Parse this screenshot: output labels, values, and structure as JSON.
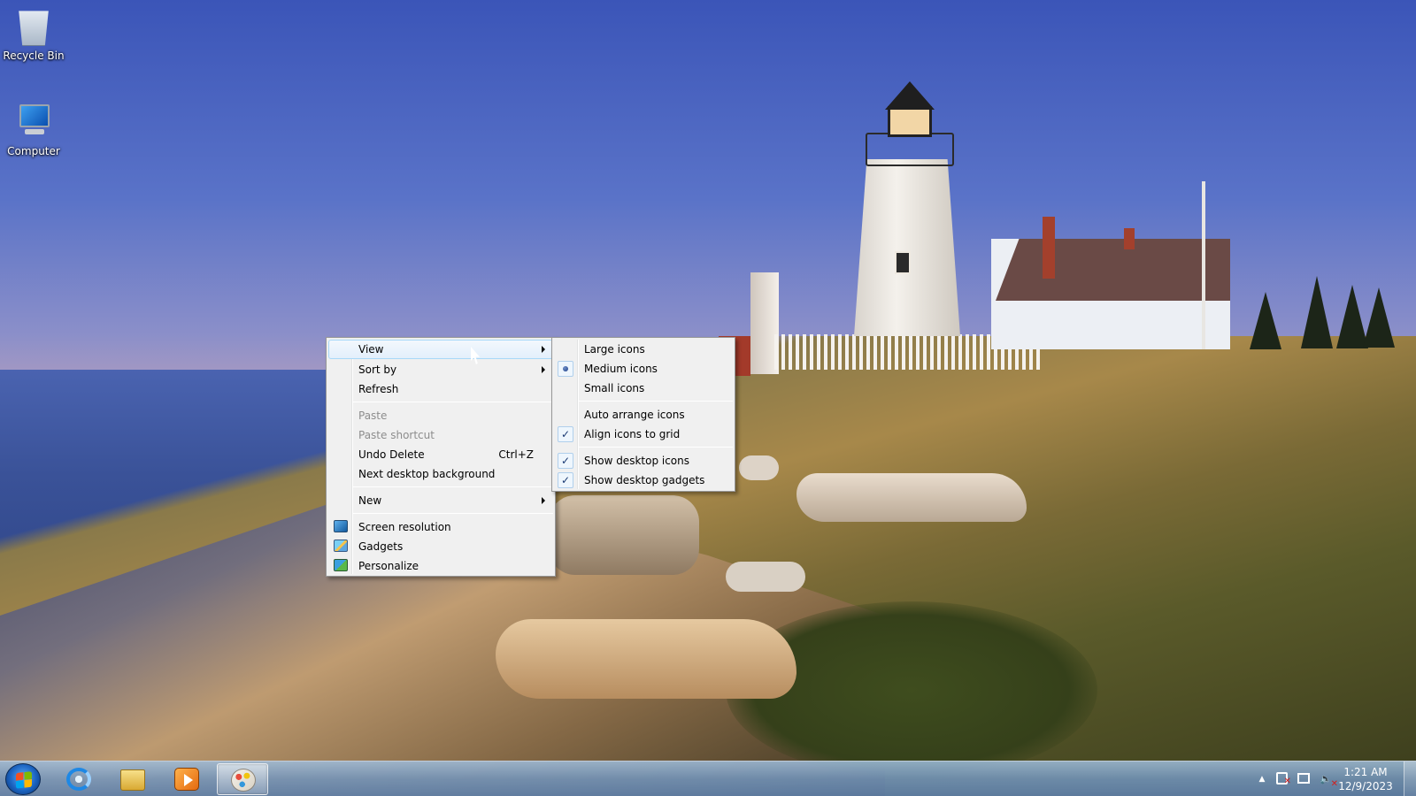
{
  "desktop": {
    "icons": [
      {
        "label": "Recycle Bin",
        "icon": "recycle-bin-icon"
      },
      {
        "label": "Computer",
        "icon": "computer-icon"
      }
    ]
  },
  "context_menu": {
    "items": {
      "view": "View",
      "sort_by": "Sort by",
      "refresh": "Refresh",
      "paste": "Paste",
      "paste_shortcut": "Paste shortcut",
      "undo_delete": "Undo Delete",
      "undo_delete_shortcut": "Ctrl+Z",
      "next_background": "Next desktop background",
      "new": "New",
      "screen_resolution": "Screen resolution",
      "gadgets": "Gadgets",
      "personalize": "Personalize"
    },
    "highlighted": "View"
  },
  "view_submenu": {
    "items": {
      "large_icons": "Large icons",
      "medium_icons": "Medium icons",
      "small_icons": "Small icons",
      "auto_arrange": "Auto arrange icons",
      "align_to_grid": "Align icons to grid",
      "show_desktop_icons": "Show desktop icons",
      "show_desktop_gadgets": "Show desktop gadgets"
    },
    "selected_size": "Medium icons",
    "checked": [
      "Align icons to grid",
      "Show desktop icons",
      "Show desktop gadgets"
    ],
    "check_glyph": "✓"
  },
  "taskbar": {
    "pinned": [
      "start-orb-icon",
      "internet-explorer-icon",
      "windows-explorer-icon",
      "media-player-icon",
      "paint-icon"
    ],
    "active_app": "paint-icon",
    "tray": {
      "expand_glyph": "▲",
      "volume_glyph": "🔈",
      "time": "1:21 AM",
      "date": "12/9/2023"
    }
  },
  "colors": {
    "menu_background": "#f0f0f0",
    "menu_highlight_border": "#a8d8f8",
    "taskbar_tint": "#7396be"
  }
}
